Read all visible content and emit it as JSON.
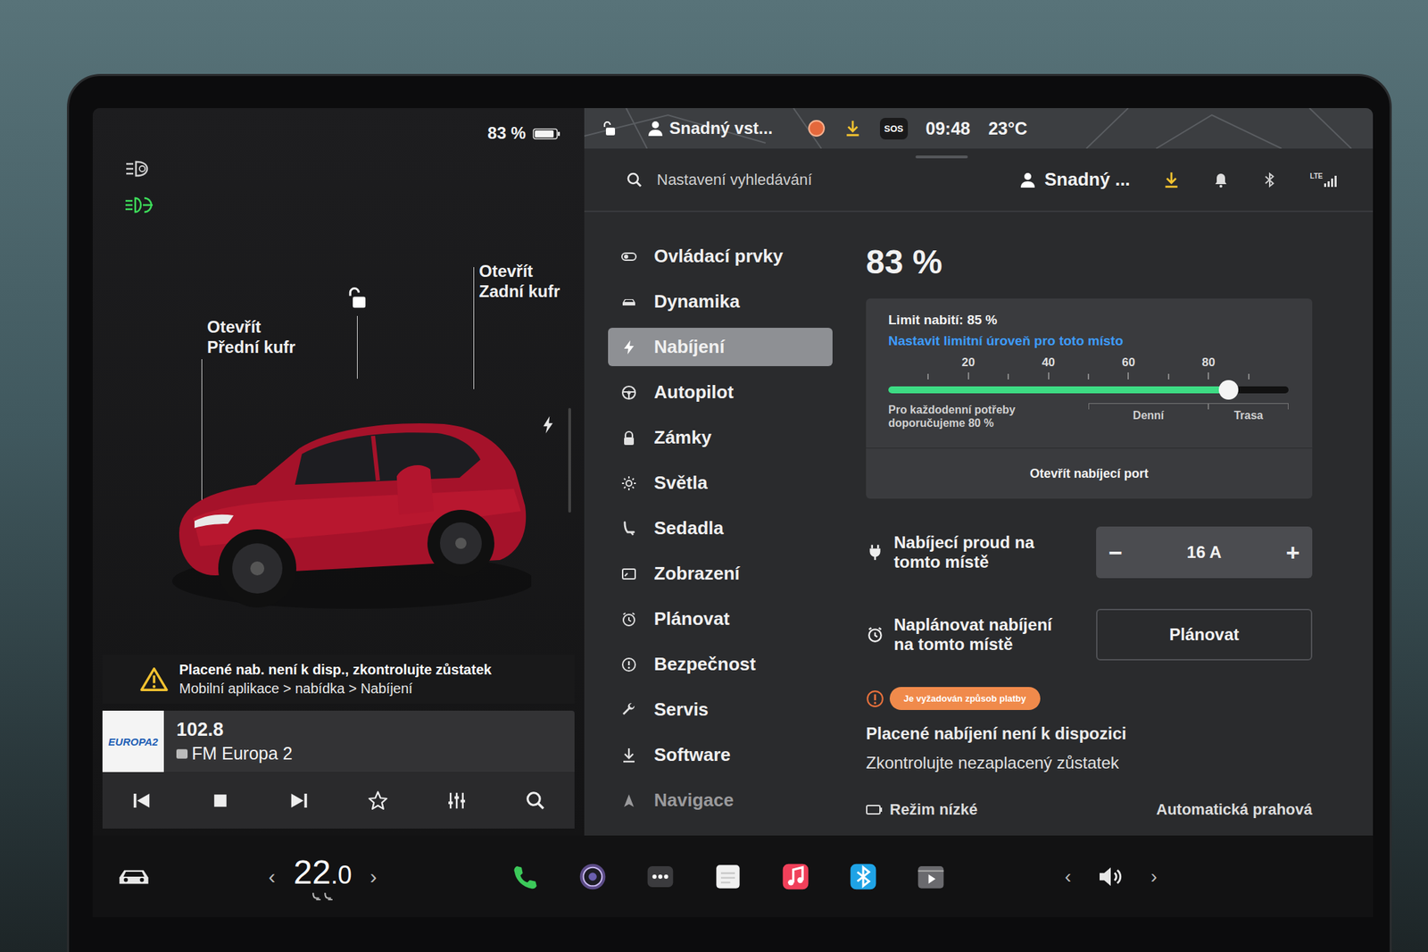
{
  "left_panel": {
    "battery": "83 %",
    "locked": false,
    "frunk": {
      "action": "Otevřít",
      "label": "Přední kufr"
    },
    "trunk": {
      "action": "Otevřít",
      "label": "Zadní kufr"
    }
  },
  "alert": {
    "title": "Placené nab. není k disp., zkontrolujte zůstatek",
    "path": "Mobilní aplikace > nabídka > Nabíjení"
  },
  "media": {
    "logo": "EUROPA2",
    "frequency": "102.8",
    "station": "FM Europa 2",
    "playing": true
  },
  "status_bar": {
    "profile": "Snadný vst...",
    "sos": "SOS",
    "time": "09:48",
    "temperature": "23°C"
  },
  "search": {
    "placeholder": "Nastavení vyhledávání"
  },
  "header": {
    "profile": "Snadný ...",
    "network": "LTE"
  },
  "sidebar": {
    "items": [
      {
        "label": "Ovládací prvky",
        "selected": false
      },
      {
        "label": "Dynamika",
        "selected": false
      },
      {
        "label": "Nabíjení",
        "selected": true
      },
      {
        "label": "Autopilot",
        "selected": false
      },
      {
        "label": "Zámky",
        "selected": false
      },
      {
        "label": "Světla",
        "selected": false
      },
      {
        "label": "Sedadla",
        "selected": false
      },
      {
        "label": "Zobrazení",
        "selected": false
      },
      {
        "label": "Plánovat",
        "selected": false
      },
      {
        "label": "Bezpečnost",
        "selected": false
      },
      {
        "label": "Servis",
        "selected": false
      },
      {
        "label": "Software",
        "selected": false
      },
      {
        "label": "Navigace",
        "selected": false
      }
    ]
  },
  "charging": {
    "percent": "83 %",
    "limit_label": "Limit nabití: 85 %",
    "link": "Nastavit limitní úroveň pro toto místo",
    "ticks": [
      "20",
      "40",
      "60",
      "80"
    ],
    "level": 0.85,
    "hint": "Pro každodenní potřeby doporučujeme 80 %",
    "ranges": [
      "Denní",
      "Trasa"
    ],
    "port_button": "Otevřít nabíjecí port",
    "current": {
      "label": "Nabíjecí proud na tomto místě",
      "minus": "−",
      "value": "16 A",
      "plus": "+"
    },
    "schedule": {
      "label": "Naplánovat nabíjení na tomto místě",
      "button": "Plánovat"
    },
    "payment": {
      "badge": "Je vyžadován způsob platby",
      "title": "Placené nabíjení není k dispozici",
      "subtitle": "Zkontrolujte nezaplacený zůstatek"
    },
    "more": [
      "Režim nízké",
      "Automatická prahová"
    ]
  },
  "dock": {
    "temp_left": "‹",
    "temp_whole": "22",
    "temp_fraction": ".0",
    "temp_right": "›",
    "vol_left": "‹",
    "vol_right": "›"
  }
}
